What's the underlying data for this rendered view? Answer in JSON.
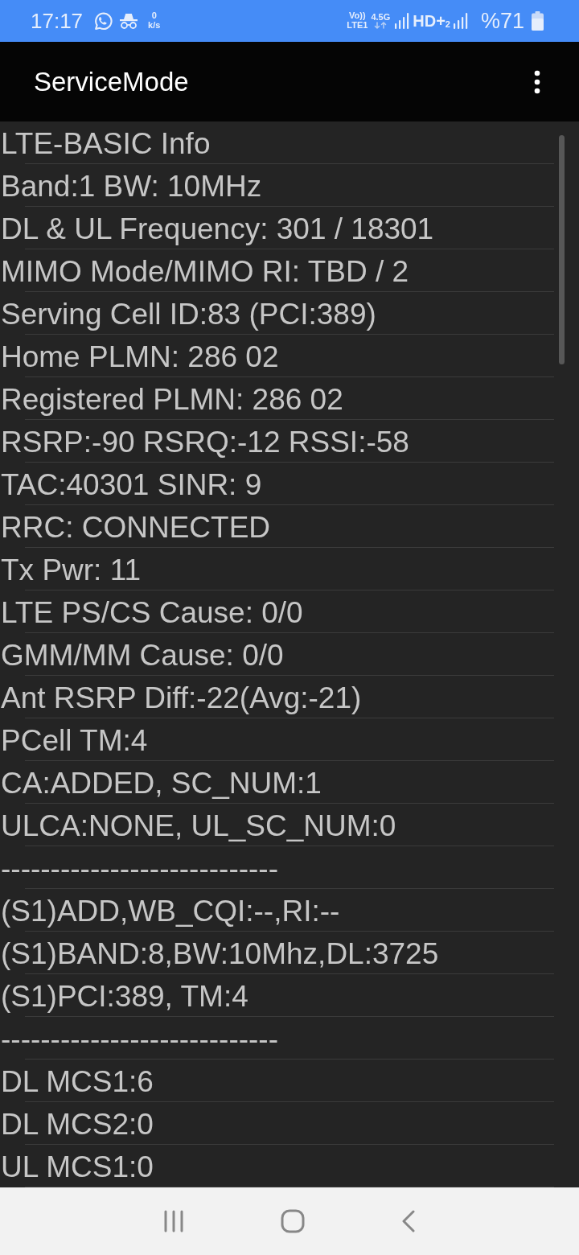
{
  "status_bar": {
    "time": "17:17",
    "speed_value": "0",
    "speed_unit": "k/s",
    "volte": "Vo))",
    "lte": "LTE1",
    "network_type": "4.5G",
    "hd_voice": "HD+$_{2}$",
    "battery": "%71"
  },
  "app_bar": {
    "title": "ServiceMode"
  },
  "info_rows": [
    "LTE-BASIC Info",
    "Band:1 BW: 10MHz",
    "DL & UL Frequency: 301 / 18301",
    "MIMO Mode/MIMO RI: TBD / 2",
    "Serving Cell ID:83 (PCI:389)",
    "Home PLMN: 286 02",
    "Registered PLMN: 286 02",
    "RSRP:-90 RSRQ:-12 RSSI:-58",
    "TAC:40301 SINR: 9",
    "RRC: CONNECTED",
    "Tx Pwr: 11",
    "LTE PS/CS Cause: 0/0",
    "GMM/MM Cause: 0/0",
    "Ant RSRP Diff:-22(Avg:-21)",
    "PCell TM:4",
    "CA:ADDED, SC_NUM:1",
    "ULCA:NONE, UL_SC_NUM:0",
    "----------------------------",
    "(S1)ADD,WB_CQI:--,RI:--",
    "(S1)BAND:8,BW:10Mhz,DL:3725",
    "(S1)PCI:389, TM:4",
    "----------------------------",
    "DL MCS1:6",
    "DL MCS2:0",
    "UL MCS1:0"
  ]
}
